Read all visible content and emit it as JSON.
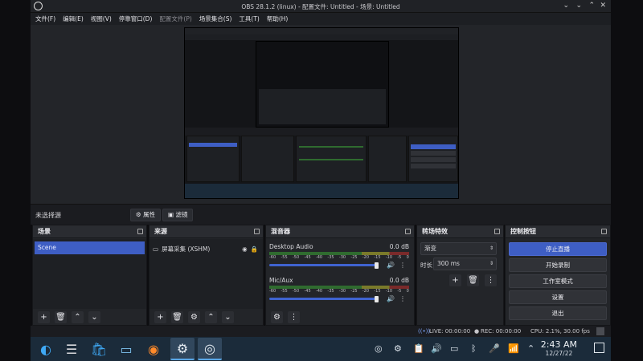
{
  "window": {
    "title": "OBS 28.1.2 (linux) - 配置文件: Untitled - 场景: Untitled"
  },
  "menu": [
    "文件(F)",
    "编辑(E)",
    "视图(V)",
    "停靠窗口(D)",
    "配置文件(P)",
    "场景集合(S)",
    "工具(T)",
    "帮助(H)"
  ],
  "source_toolbar": {
    "no_source": "未选择源",
    "properties": "属性",
    "filters": "滤镜"
  },
  "scenes": {
    "title": "场景",
    "items": [
      "Scene"
    ]
  },
  "sources": {
    "title": "来源",
    "items": [
      {
        "name": "屏幕采集 (XSHM)"
      }
    ]
  },
  "mixer": {
    "title": "混音器",
    "scale": [
      "-60",
      "-55",
      "-50",
      "-45",
      "-40",
      "-35",
      "-30",
      "-25",
      "-20",
      "-15",
      "-10",
      "-5",
      "0"
    ],
    "channels": [
      {
        "name": "Desktop Audio",
        "db": "0.0 dB",
        "volume": 0.95
      },
      {
        "name": "Mic/Aux",
        "db": "0.0 dB",
        "volume": 0.95
      }
    ]
  },
  "transitions": {
    "title": "转场特效",
    "type": "渐变",
    "duration_label": "时长",
    "duration": "300 ms"
  },
  "controls": {
    "title": "控制按钮",
    "buttons": [
      "停止直播",
      "开始录制",
      "工作室模式",
      "设置",
      "退出"
    ]
  },
  "status": {
    "live": "LIVE: 00:00:00",
    "rec": "REC: 00:00:00",
    "cpu": "CPU: 2.1%, 30.00 fps"
  },
  "taskbar": {
    "time": "2:43 AM",
    "date": "12/27/22"
  }
}
